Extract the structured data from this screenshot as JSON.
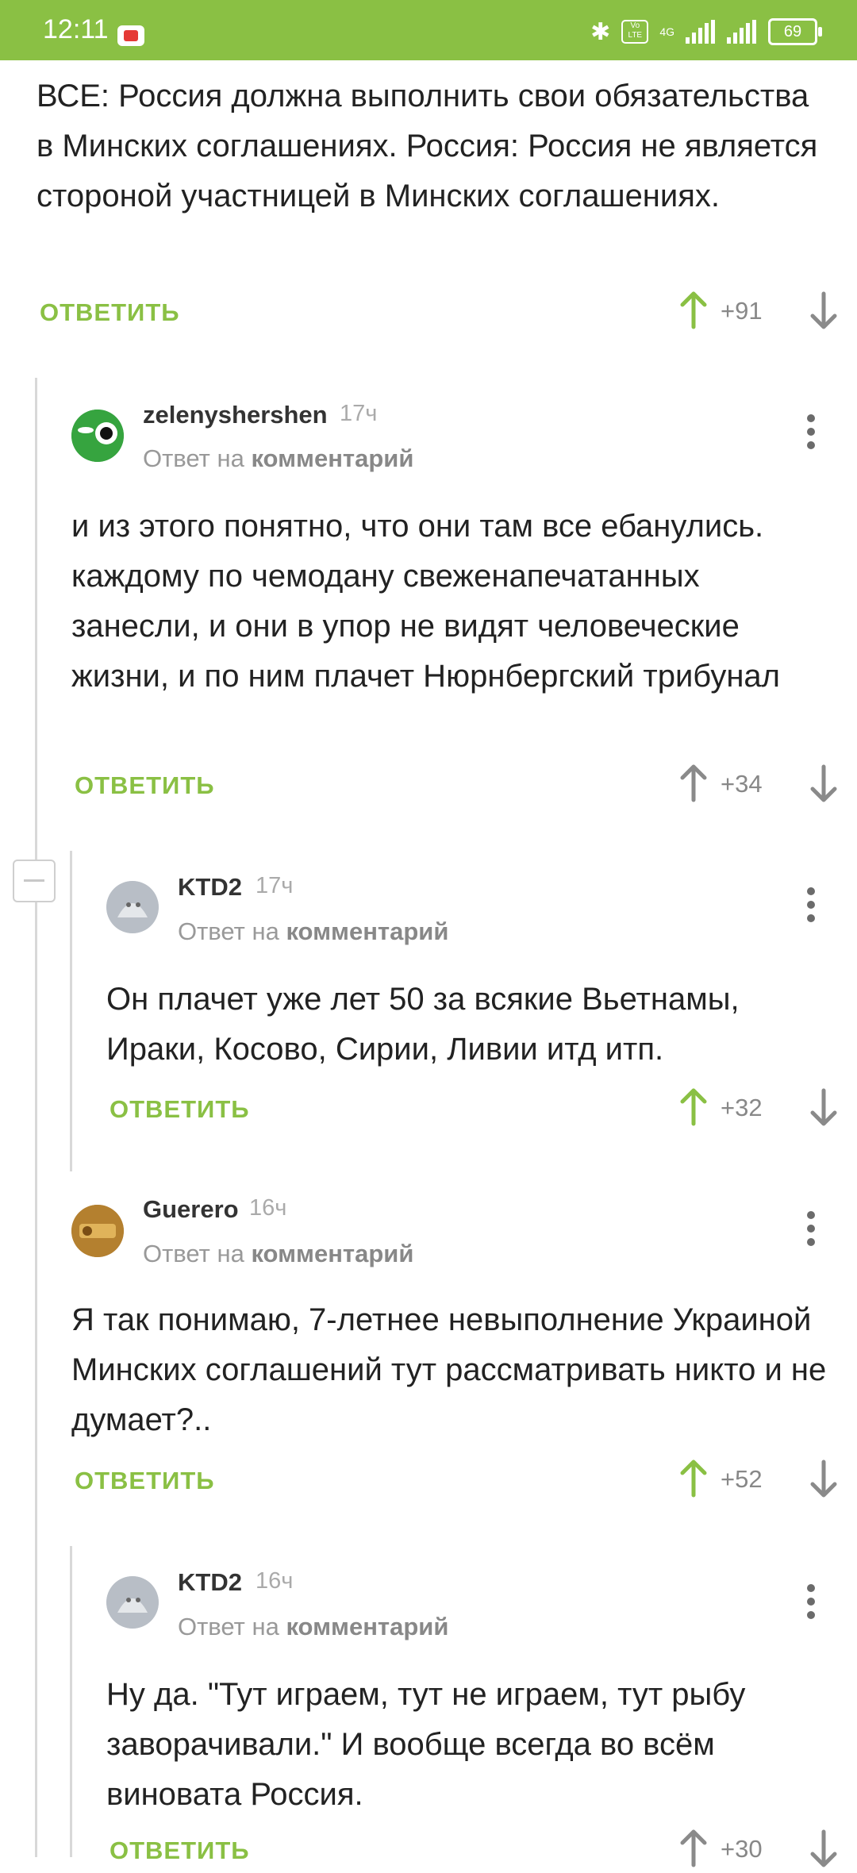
{
  "status_bar": {
    "time": "12:11",
    "battery": "69",
    "network": "4G",
    "volte": "Vo LTE"
  },
  "top_comment": {
    "text": "ВСЕ: Россия должна выполнить свои обязательства в Минских соглашениях. Россия: Россия не является стороной участницей в Минских соглашениях.",
    "reply_label": "ОТВЕТИТЬ",
    "score": "+91"
  },
  "comments": [
    {
      "author": "zelenyshershen",
      "age": "17ч",
      "reply_to_prefix": "Ответ на",
      "reply_to_link": "комментарий",
      "text": "и из этого понятно, что они там все ебанулись. каждому по чемодану свеженапечатанных занесли, и они в упор не видят человеческие жизни, и по ним плачет Нюрнбергский трибунал",
      "reply_label": "ОТВЕТИТЬ",
      "score": "+34"
    },
    {
      "author": "KTD2",
      "age": "17ч",
      "reply_to_prefix": "Ответ на",
      "reply_to_link": "комментарий",
      "text": "Он плачет уже лет 50 за всякие Вьетнамы, Ираки, Косово, Сирии, Ливии итд итп.",
      "reply_label": "ОТВЕТИТЬ",
      "score": "+32"
    },
    {
      "author": "Guerero",
      "age": "16ч",
      "reply_to_prefix": "Ответ на",
      "reply_to_link": "комментарий",
      "text": "Я так понимаю, 7-летнее невыполнение Украиной Минских соглашений тут рассматривать никто и не думает?..",
      "reply_label": "ОТВЕТИТЬ",
      "score": "+52"
    },
    {
      "author": "KTD2",
      "age": "16ч",
      "reply_to_prefix": "Ответ на",
      "reply_to_link": "комментарий",
      "text": "Ну да. \"Тут играем, тут не играем, тут рыбу заворачивали.\" И вообще всегда во всём виновата Россия.",
      "reply_label": "ОТВЕТИТЬ",
      "score": "+30"
    }
  ],
  "colors": {
    "accent": "#8ac044",
    "upvote_active": "#8ac044",
    "muted": "#8a8a8a"
  }
}
